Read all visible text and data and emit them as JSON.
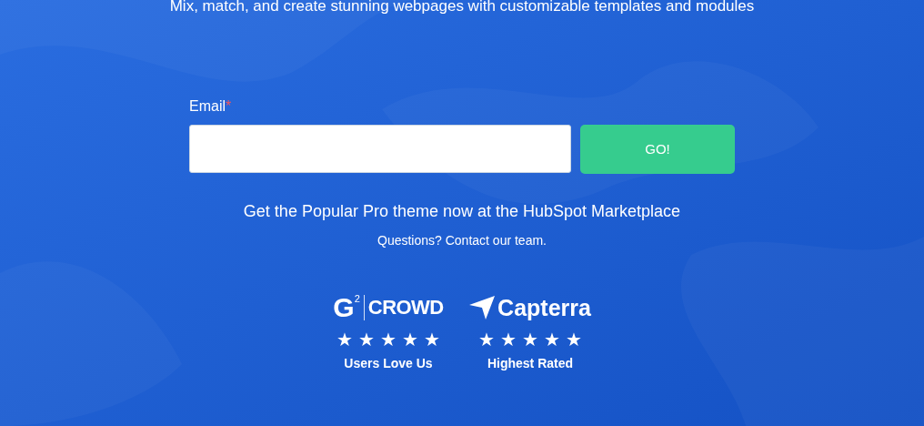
{
  "headline": "Mix, match, and create stunning webpages with customizable templates and modules",
  "form": {
    "label": "Email",
    "required_mark": "*",
    "button": "GO!"
  },
  "tagline": "Get the Popular Pro theme now at the HubSpot Marketplace",
  "contact": "Questions? Contact our team.",
  "badges": [
    {
      "kind": "g2",
      "logo_mark": "G",
      "logo_sup": "2",
      "logo_text": "CROWD",
      "stars": 5,
      "caption": "Users Love Us"
    },
    {
      "kind": "capterra",
      "logo_text": "Capterra",
      "stars": 5,
      "caption": "Highest Rated"
    }
  ]
}
